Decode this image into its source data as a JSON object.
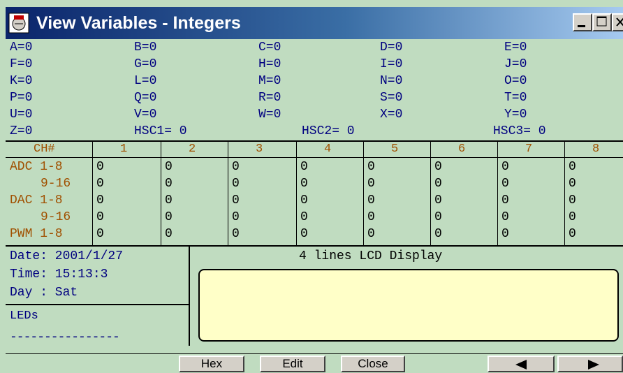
{
  "window": {
    "title": "View Variables - Integers",
    "icon": "app-icon",
    "controls": [
      "minimize-icon",
      "maximize-icon",
      "close-icon"
    ]
  },
  "variables": [
    {
      "name": "A",
      "text": "A=0"
    },
    {
      "name": "B",
      "text": "B=0"
    },
    {
      "name": "C",
      "text": "C=0"
    },
    {
      "name": "D",
      "text": "D=0"
    },
    {
      "name": "E",
      "text": "E=0"
    },
    {
      "name": "F",
      "text": "F=0"
    },
    {
      "name": "G",
      "text": "G=0"
    },
    {
      "name": "H",
      "text": "H=0"
    },
    {
      "name": "I",
      "text": "I=0"
    },
    {
      "name": "J",
      "text": "J=0"
    },
    {
      "name": "K",
      "text": "K=0"
    },
    {
      "name": "L",
      "text": "L=0"
    },
    {
      "name": "M",
      "text": "M=0"
    },
    {
      "name": "N",
      "text": "N=0"
    },
    {
      "name": "O",
      "text": "O=0"
    },
    {
      "name": "P",
      "text": "P=0"
    },
    {
      "name": "Q",
      "text": "Q=0"
    },
    {
      "name": "R",
      "text": "R=0"
    },
    {
      "name": "S",
      "text": "S=0"
    },
    {
      "name": "T",
      "text": "T=0"
    },
    {
      "name": "U",
      "text": "U=0"
    },
    {
      "name": "V",
      "text": "V=0"
    },
    {
      "name": "W",
      "text": "W=0"
    },
    {
      "name": "X",
      "text": "X=0"
    },
    {
      "name": "Y",
      "text": "Y=0"
    }
  ],
  "row_z": {
    "z": "Z=0",
    "hsc1": "HSC1= 0",
    "hsc2": "HSC2= 0",
    "hsc3": "HSC3= 0"
  },
  "channel_table": {
    "header": "CH#",
    "columns": [
      "1",
      "2",
      "3",
      "4",
      "5",
      "6",
      "7",
      "8"
    ],
    "rows": [
      {
        "label": "ADC 1-8",
        "values": [
          "0",
          "0",
          "0",
          "0",
          "0",
          "0",
          "0",
          "0"
        ]
      },
      {
        "label": "9-16",
        "values": [
          "0",
          "0",
          "0",
          "0",
          "0",
          "0",
          "0",
          "0"
        ]
      },
      {
        "label": "DAC 1-8",
        "values": [
          "0",
          "0",
          "0",
          "0",
          "0",
          "0",
          "0",
          "0"
        ]
      },
      {
        "label": "9-16",
        "values": [
          "0",
          "0",
          "0",
          "0",
          "0",
          "0",
          "0",
          "0"
        ]
      },
      {
        "label": "PWM 1-8",
        "values": [
          "0",
          "0",
          "0",
          "0",
          "0",
          "0",
          "0",
          "0"
        ]
      }
    ]
  },
  "info": {
    "date": "Date: 2001/1/27",
    "time": "Time: 15:13:3",
    "day": "Day : Sat",
    "leds_label": "LEDs",
    "leds_value": "----------------"
  },
  "lcd": {
    "title": "4 lines LCD Display",
    "lines": [
      "",
      "",
      "",
      ""
    ]
  },
  "buttons": {
    "hex": "Hex",
    "edit": "Edit",
    "close": "Close",
    "prev_icon": "left-arrow-icon",
    "next_icon": "right-arrow-icon"
  },
  "colors": {
    "background": "#c0dcc0",
    "variable_text": "#000080",
    "header_text": "#a05000",
    "lcd_background": "#ffffc8",
    "titlebar_start": "#0a246a"
  }
}
